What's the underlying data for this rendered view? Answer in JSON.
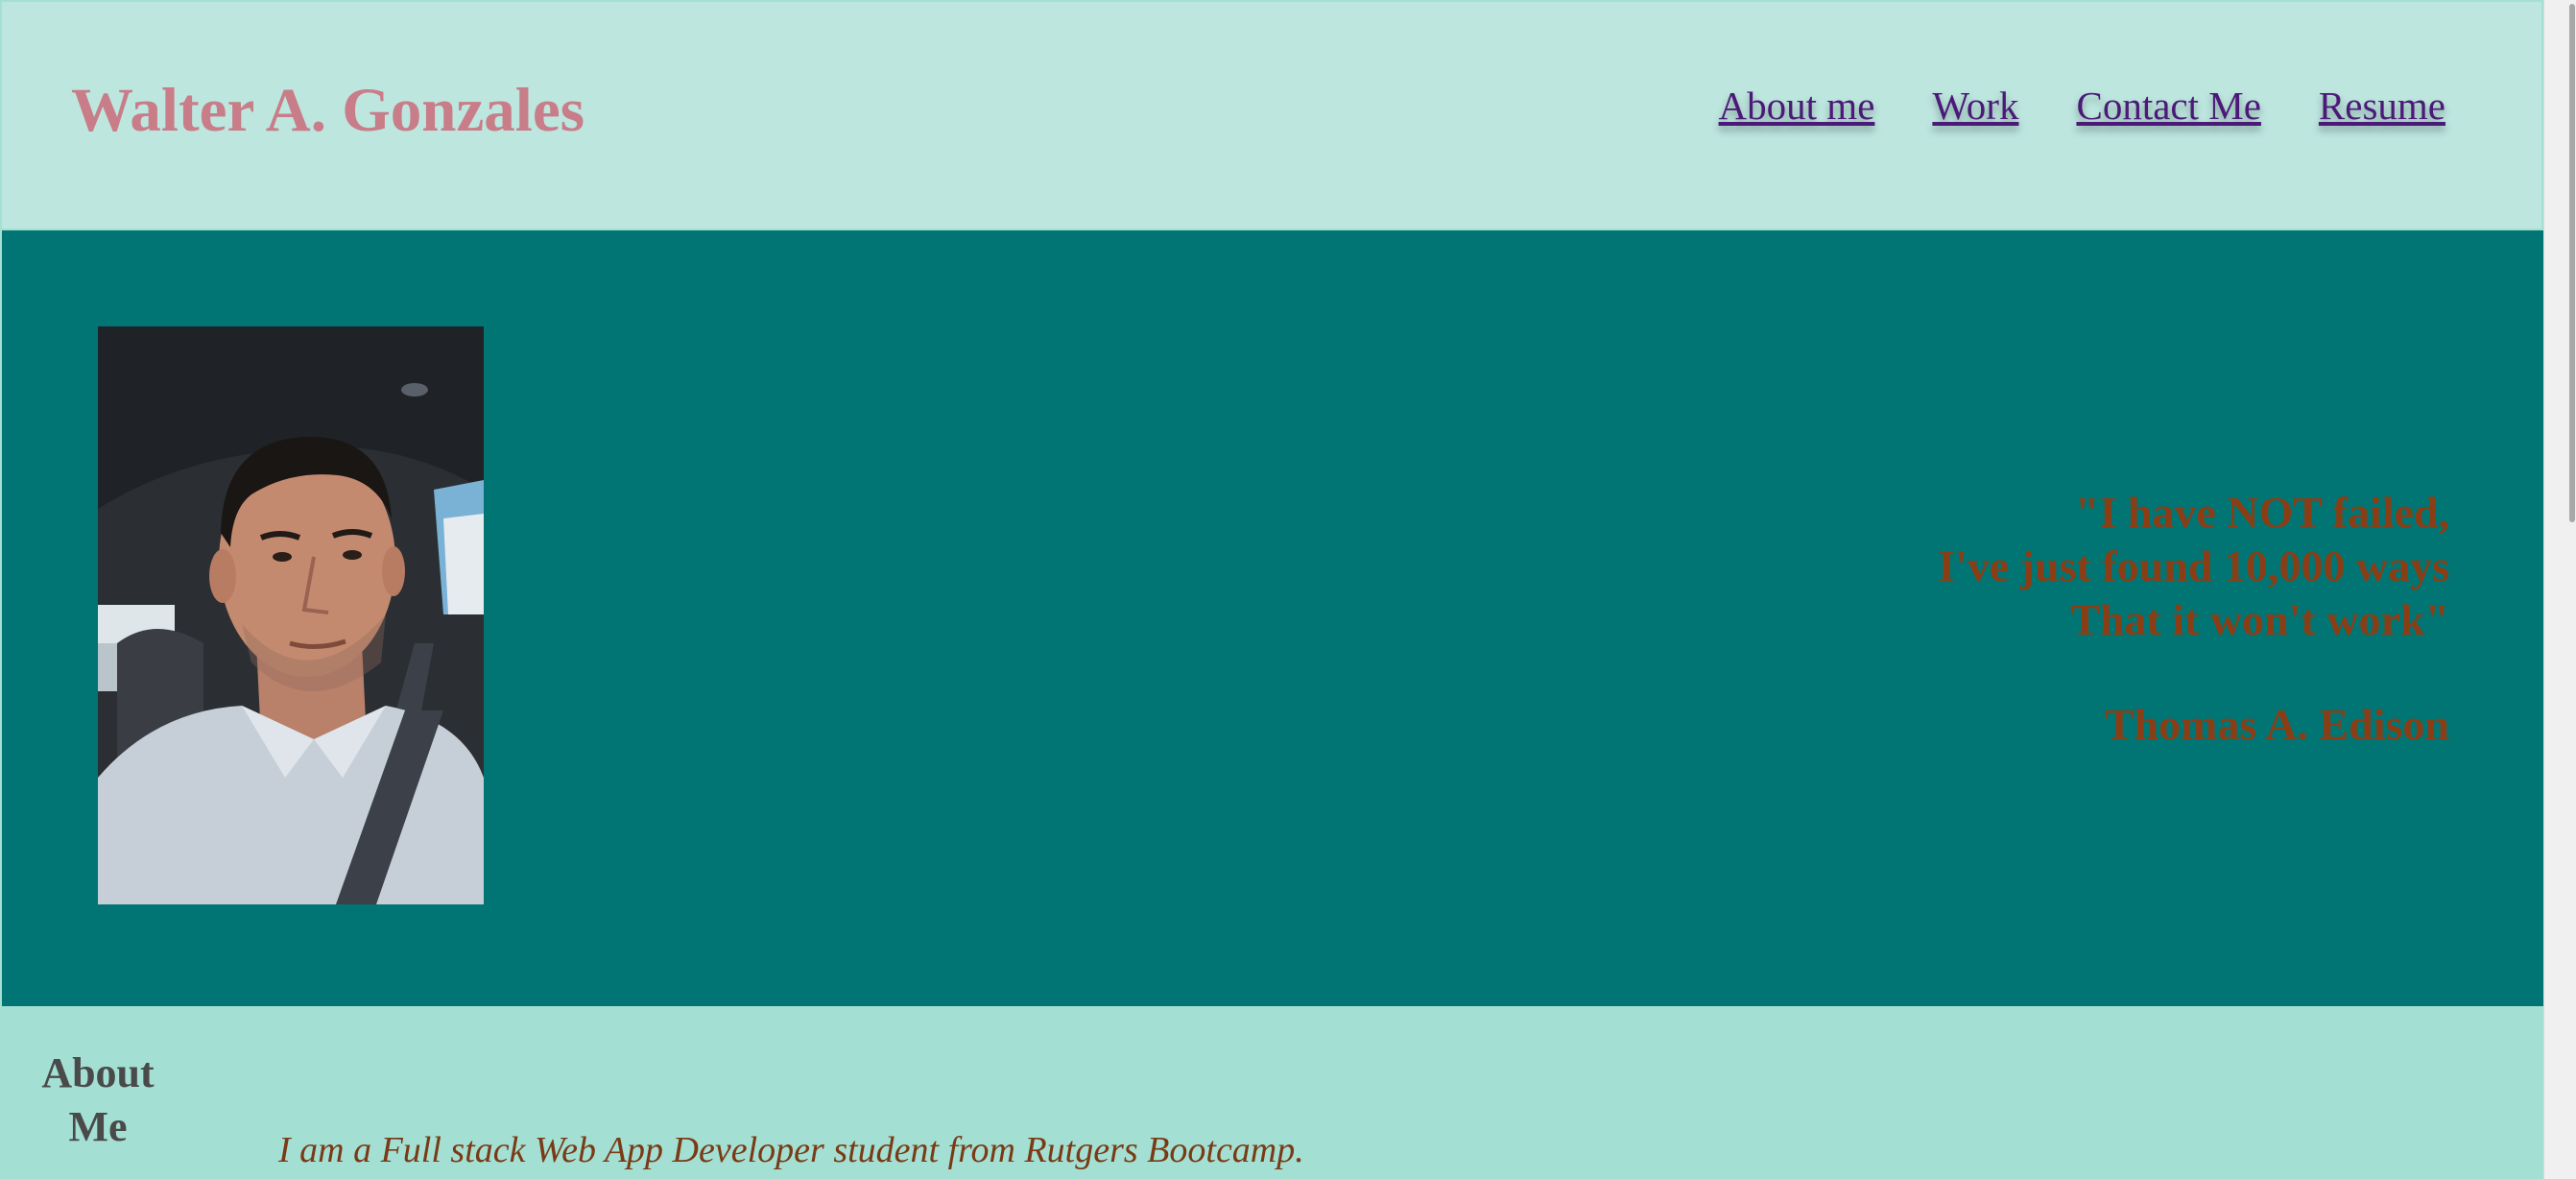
{
  "header": {
    "title": "Walter A. Gonzales",
    "nav": [
      "About me",
      "Work",
      "Contact Me",
      "Resume"
    ]
  },
  "hero": {
    "quote_lines": [
      "\"I have NOT failed,",
      "I've just found 10,000 ways",
      "That it won't work\""
    ],
    "quote_author": "Thomas A. Edison"
  },
  "about": {
    "heading": "About Me",
    "text": "I am a Full stack Web App Developer student from Rutgers Bootcamp."
  },
  "colors": {
    "header_bg": "#bde6df",
    "hero_bg": "#007574",
    "page_bg": "#a3e0d3",
    "title_color": "#c87d88",
    "nav_link_color": "#4b1a78",
    "quote_color": "#8a3e16"
  }
}
